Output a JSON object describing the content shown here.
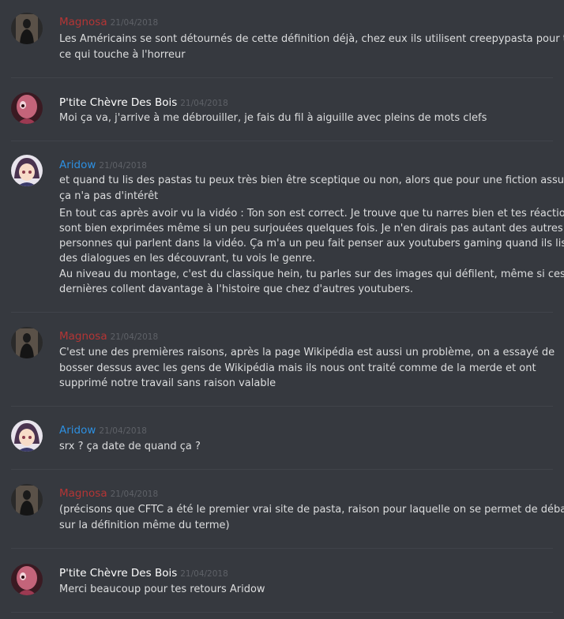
{
  "colors": {
    "magnosa": "#b43535",
    "ptite": "#ffffff",
    "aridow": "#2d8fe0"
  },
  "messages": [
    {
      "author": "Magnosa",
      "date": "21/04/2018",
      "avatar_icon": "dark-figure-avatar-icon",
      "lines": [
        "Les Américains se sont détournés de cette définition déjà, chez eux ils utilisent creepypasta pour tout",
        "ce qui touche à l'horreur"
      ]
    },
    {
      "author": "P'tite Chèvre Des Bois",
      "date": "21/04/2018",
      "avatar_icon": "pink-creature-avatar-icon",
      "lines": [
        "Moi ça va, j'arrive à me débrouiller, je fais du fil à aiguille avec pleins de mots clefs"
      ]
    },
    {
      "author": "Aridow",
      "date": "21/04/2018",
      "avatar_icon": "anime-girl-avatar-icon",
      "lines": [
        "et quand tu lis des pastas tu peux très bien être sceptique ou non, alors que pour une fiction assumée",
        "ça n'a pas d'intérêt",
        "En tout cas après avoir vu la vidéo : Ton son est correct. Je trouve que tu narres bien et tes réactions",
        "sont bien exprimées même si un peu surjouées quelques fois. Je n'en dirais pas autant des autres",
        "personnes qui parlent dans la vidéo. Ça m'a un peu fait penser aux youtubers gaming quand ils lisent",
        "des dialogues en les découvrant, tu vois le genre.",
        "Au niveau du montage, c'est du classique hein, tu parles sur des images qui défilent, même si ces",
        "dernières collent davantage à l'histoire que chez d'autres youtubers."
      ]
    },
    {
      "author": "Magnosa",
      "date": "21/04/2018",
      "avatar_icon": "dark-figure-avatar-icon",
      "lines": [
        "C'est une des premières raisons, après la page Wikipédia est aussi un problème, on a essayé de",
        "bosser dessus avec les gens de Wikipédia mais ils nous ont traité comme de la merde et ont",
        "supprimé notre travail sans raison valable"
      ]
    },
    {
      "author": "Aridow",
      "date": "21/04/2018",
      "avatar_icon": "anime-girl-avatar-icon",
      "lines": [
        "srx ? ça date de quand ça ?"
      ]
    },
    {
      "author": "Magnosa",
      "date": "21/04/2018",
      "avatar_icon": "dark-figure-avatar-icon",
      "lines": [
        "(précisons que CFTC a été le premier vrai site de pasta, raison pour laquelle on se permet de débattre",
        "sur la définition même du terme)"
      ]
    },
    {
      "author": "P'tite Chèvre Des Bois",
      "date": "21/04/2018",
      "avatar_icon": "pink-creature-avatar-icon",
      "lines": [
        "Merci beaucoup pour tes retours Aridow"
      ]
    }
  ]
}
